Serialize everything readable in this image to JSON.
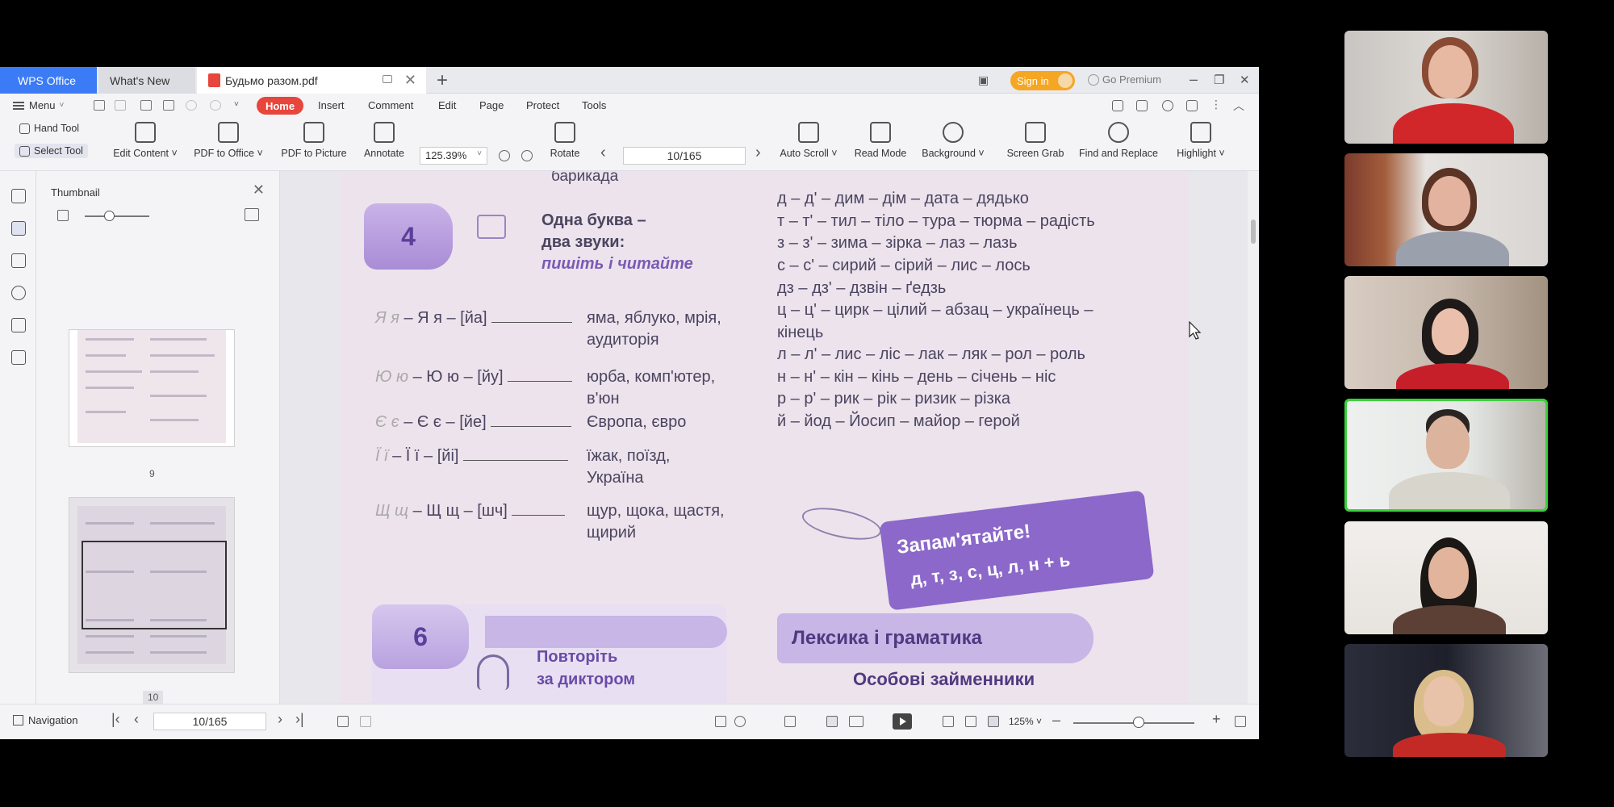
{
  "tabs": {
    "wps": "WPS Office",
    "whats_new": "What's New",
    "doc": "Будьмо разом.pdf",
    "plus": "+"
  },
  "titlebar": {
    "sign_in": "Sign in",
    "premium": "Go Premium",
    "min": "–",
    "max": "❐",
    "close": "✕"
  },
  "menu": {
    "menu_label": "Menu",
    "tabs": [
      "Home",
      "Insert",
      "Comment",
      "Edit",
      "Page",
      "Protect",
      "Tools"
    ]
  },
  "toolbar": {
    "hand_tool": "Hand Tool",
    "select_tool": "Select Tool",
    "edit_content": "Edit Content ˅",
    "pdf_to_office": "PDF to Office ˅",
    "pdf_to_picture": "PDF to Picture",
    "annotate": "Annotate",
    "zoom": "125.39%",
    "rotate": "Rotate",
    "page": "10/165",
    "auto_scroll": "Auto Scroll ˅",
    "read_mode": "Read Mode",
    "background": "Background ˅",
    "screen_grab": "Screen Grab",
    "find_replace": "Find and Replace",
    "highlight": "Highlight ˅"
  },
  "thumbnail_pane": {
    "title": "Thumbnail",
    "pages": [
      "9",
      "10"
    ]
  },
  "document": {
    "top_word": "барикада",
    "sec4_num": "4",
    "sec4_title1": "Одна буква –",
    "sec4_title2": "два звуки:",
    "sec4_title3": "пишіть і читайте",
    "left_rows": [
      {
        "hand": "Я я",
        "label": "– Я я – [йа]",
        "words1": "яма, яблуко, мрія,",
        "words2": "аудиторія"
      },
      {
        "hand": "Ю ю",
        "label": "– Ю ю – [йу]",
        "words1": "юрба, комп'ютер,",
        "words2": "в'юн"
      },
      {
        "hand": "Є є",
        "label": "– Є є – [йе]",
        "words1": "Європа, євро",
        "words2": ""
      },
      {
        "hand": "Ї ї",
        "label": "– Ї ї – [йі]",
        "words1": "їжак, поїзд,",
        "words2": "Україна"
      },
      {
        "hand": "Щ щ",
        "label": "– Щ щ – [шч]",
        "words1": "щур, щока, щастя,",
        "words2": "щирий"
      }
    ],
    "right_rows": [
      "д – д' – дим – дім – дата – дядько",
      "т – т' – тил – тіло – тура – тюрма – радість",
      "з – з' – зима – зірка – лаз – лазь",
      "с – с' – сирий – сірий – лис – лось",
      "дз – дз' – дзвін – ґедзь",
      "ц – ц' – цирк – цілий – абзац – українець –",
      "кінець",
      "л – л' – лис – ліс – лак – ляк – рол – роль",
      "н – н' – кін – кінь – день – січень – ніс",
      "р – р' – рик – рік – ризик – різка",
      "й – йод – Йосип – майор – герой"
    ],
    "remember_title": "Запам'ятайте!",
    "remember_letters": "д, т, з, с, ц, л, н + ь",
    "sec6_num": "6",
    "sec6_title1": "Повторіть",
    "sec6_title2": "за диктором",
    "lex_title": "Лексика і граматика",
    "lex_sub": "Особові займенники"
  },
  "statusbar": {
    "navigation": "Navigation",
    "page": "10/165",
    "zoom": "125% ˅",
    "minus": "–",
    "plus": "+"
  }
}
